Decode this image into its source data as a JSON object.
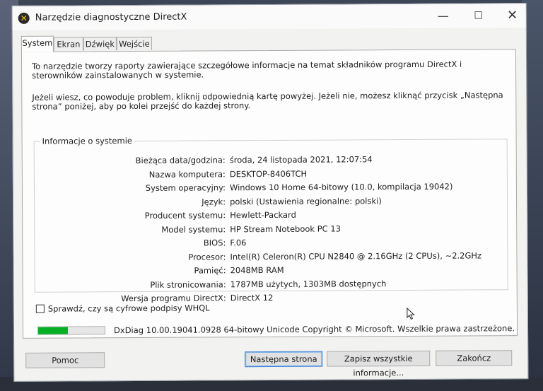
{
  "window": {
    "title": "Narzędzie diagnostyczne DirectX",
    "minimize_glyph": "—",
    "maximize_glyph": "☐",
    "close_glyph": "✕"
  },
  "tabs": [
    {
      "label": "System",
      "active": true
    },
    {
      "label": "Ekran",
      "active": false
    },
    {
      "label": "Dźwięk",
      "active": false
    },
    {
      "label": "Wejście",
      "active": false
    }
  ],
  "intro": {
    "paragraph1": "To narzędzie tworzy raporty zawierające szczegółowe informacje na temat składników programu DirectX i sterowników zainstalowanych w systemie.",
    "paragraph2": "Jeżeli wiesz, co powoduje problem, kliknij odpowiednią kartę powyżej. Jeżeli nie, możesz kliknąć przycisk „Następna strona” poniżej, aby po kolei przejść do każdej strony."
  },
  "system_info": {
    "group_label": "Informacje o systemie",
    "rows": [
      {
        "label": "Bieżąca data/godzina:",
        "value": "środa, 24 listopada 2021, 12:07:54"
      },
      {
        "label": "Nazwa komputera:",
        "value": "DESKTOP-8406TCH"
      },
      {
        "label": "System operacyjny:",
        "value": "Windows 10 Home 64-bitowy (10.0, kompilacja 19042)"
      },
      {
        "label": "Język:",
        "value": "polski (Ustawienia regionalne: polski)"
      },
      {
        "label": "Producent systemu:",
        "value": "Hewlett-Packard"
      },
      {
        "label": "Model systemu:",
        "value": "HP Stream Notebook PC 13"
      },
      {
        "label": "BIOS:",
        "value": "F.06"
      },
      {
        "label": "Procesor:",
        "value": "Intel(R) Celeron(R) CPU  N2840  @ 2.16GHz (2 CPUs), ~2.2GHz"
      },
      {
        "label": "Pamięć:",
        "value": "2048MB RAM"
      },
      {
        "label": "Plik stronicowania:",
        "value": "1787MB użytych, 1303MB dostępnych"
      },
      {
        "label": "Wersja programu DirectX:",
        "value": "DirectX 12"
      }
    ]
  },
  "whql_checkbox": {
    "label": "Sprawdź, czy są cyfrowe podpisy WHQL",
    "checked": false
  },
  "progress": {
    "fraction": 0.45,
    "color": "#06b025"
  },
  "copyright": "DxDiag 10.00.19041.0928 64-bitowy Unicode  Copyright © Microsoft. Wszelkie prawa zastrzeżone.",
  "buttons": {
    "help": "Pomoc",
    "next": "Następna strona",
    "save_all": "Zapisz wszystkie informacje...",
    "exit": "Zakończ"
  }
}
